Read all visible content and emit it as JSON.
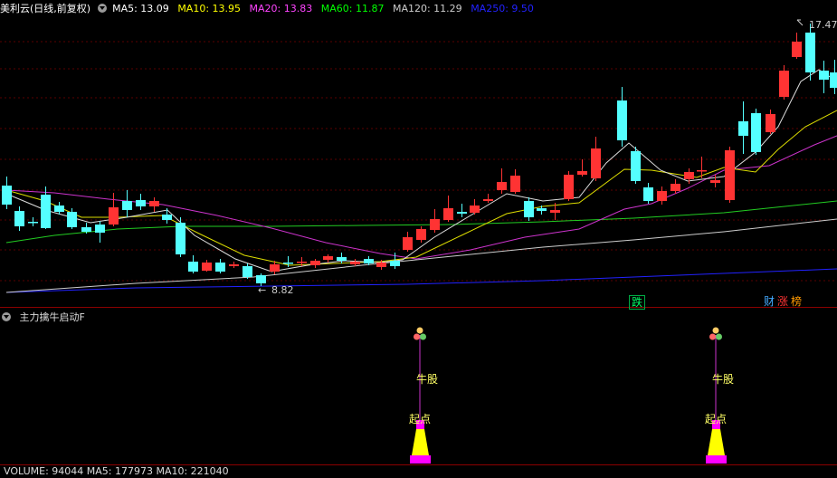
{
  "header": {
    "title": "美利云(日线,前复权)",
    "ma": [
      {
        "label": "MA5: 13.09",
        "color": "#ffffff"
      },
      {
        "label": "MA10: 13.95",
        "color": "#ffff00"
      },
      {
        "label": "MA20: 13.83",
        "color": "#ff44ff"
      },
      {
        "label": "MA60: 11.87",
        "color": "#00ff00"
      },
      {
        "label": "MA120: 11.29",
        "color": "#cccccc"
      },
      {
        "label": "MA250: 9.50",
        "color": "#2222ff"
      }
    ]
  },
  "chart": {
    "high_label": "17.47",
    "low_label": "8.82",
    "tags": [
      {
        "text": "跌",
        "color": "#00ff66"
      },
      {
        "text": "财",
        "color": "#44aaff"
      },
      {
        "text": "涨",
        "color": "#ff3333"
      },
      {
        "text": "榜",
        "color": "#ff9900"
      }
    ],
    "colors": {
      "up": "#ff3333",
      "down": "#54ffff",
      "ma250": "#2222ff"
    }
  },
  "indicator": {
    "title": "主力擒牛启动F",
    "signal_top": "牛股",
    "signal_bottom": "起点"
  },
  "footer": {
    "text": "VOLUME: 94044  MA5: 177973  MA10: 221040"
  }
}
